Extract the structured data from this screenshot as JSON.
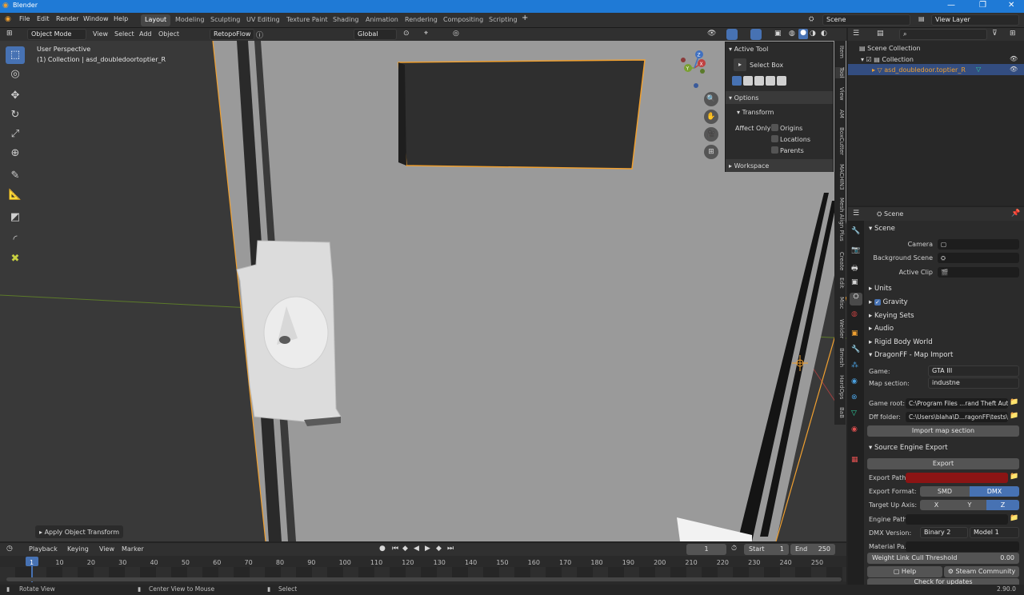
{
  "app": {
    "title": "Blender",
    "version": "2.90.0"
  },
  "menu": [
    "File",
    "Edit",
    "Render",
    "Window",
    "Help"
  ],
  "workspaces": [
    "Layout",
    "Modeling",
    "Sculpting",
    "UV Editing",
    "Texture Paint",
    "Shading",
    "Animation",
    "Rendering",
    "Compositing",
    "Scripting"
  ],
  "scene_field": "Scene",
  "viewlayer_field": "View Layer",
  "viewport": {
    "mode": "Object Mode",
    "menus": [
      "View",
      "Select",
      "Add",
      "Object"
    ],
    "addon": "RetopoFlow",
    "transform": "Global",
    "perspective": "User Perspective",
    "collection_info": "(1) Collection | asd_doubledoortoptier_R",
    "apply_panel": "Apply Object Transform"
  },
  "gizmo": {
    "x": "X",
    "y": "Y",
    "z": "Z"
  },
  "tool_panel": {
    "active_tool": "Active Tool",
    "select_box": "Select Box",
    "options": "Options",
    "transform": "Transform",
    "affect_only": "Affect Only",
    "origins": "Origins",
    "locations": "Locations",
    "parents": "Parents",
    "workspace": "Workspace"
  },
  "side_tabs": [
    "Item",
    "Tool",
    "View",
    "AM",
    "BoxCutter",
    "MACHIN3",
    "Mesh Align Plus",
    "Create",
    "Edit",
    "Misc",
    "Welder",
    "Bmesh",
    "HardOps",
    "BaB"
  ],
  "outliner": {
    "scene_collection": "Scene Collection",
    "collection": "Collection",
    "object": "asd_doubledoor.toptier_R"
  },
  "props": {
    "header": "Scene",
    "scene_section": "Scene",
    "camera": "Camera",
    "background_scene": "Background Scene",
    "active_clip": "Active Clip",
    "units": "Units",
    "gravity": "Gravity",
    "keying_sets": "Keying Sets",
    "audio": "Audio",
    "rigid_body": "Rigid Body World",
    "dragon": "DragonFF - Map Import",
    "game_label": "Game:",
    "game_value": "GTA III",
    "map_label": "Map section:",
    "map_value": "industne",
    "game_root_label": "Game root:",
    "game_root_value": "C:\\Program Files ...rand Theft Auto 3",
    "dff_label": "Dff folder:",
    "dff_value": "C:\\Users\\blaha\\D...ragonFF\\tests\\dff",
    "import_btn": "Import map section",
    "source": "Source Engine Export",
    "export_btn": "Export",
    "export_path": "Export Path:",
    "export_format": "Export Format:",
    "smd": "SMD",
    "dmx": "DMX",
    "up_axis": "Target Up Axis:",
    "ax_x": "X",
    "ax_y": "Y",
    "ax_z": "Z",
    "engine_path": "Engine Path:",
    "dmx_version": "DMX Version:",
    "binary": "Binary 2",
    "model": "Model 1",
    "material": "Material Pa...",
    "weight_cull": "Weight Link Cull Threshold",
    "weight_value": "0.00",
    "help": "Help",
    "steam": "Steam Community",
    "check": "Check for updates"
  },
  "timeline": {
    "menus": [
      "Playback",
      "Keying",
      "View",
      "Marker"
    ],
    "current": "1",
    "start_label": "Start",
    "start": "1",
    "end_label": "End",
    "end": "250",
    "ticks": [
      "1",
      "10",
      "20",
      "30",
      "40",
      "50",
      "60",
      "70",
      "80",
      "90",
      "100",
      "110",
      "120",
      "130",
      "140",
      "150",
      "160",
      "170",
      "180",
      "190",
      "200",
      "210",
      "220",
      "230",
      "240",
      "250"
    ]
  },
  "status": {
    "rotate": "Rotate View",
    "center": "Center View to Mouse",
    "select": "Select"
  },
  "colors": {
    "accent": "#4772b3",
    "selection": "#f0a030",
    "export_path_bg": "#8b1414"
  }
}
